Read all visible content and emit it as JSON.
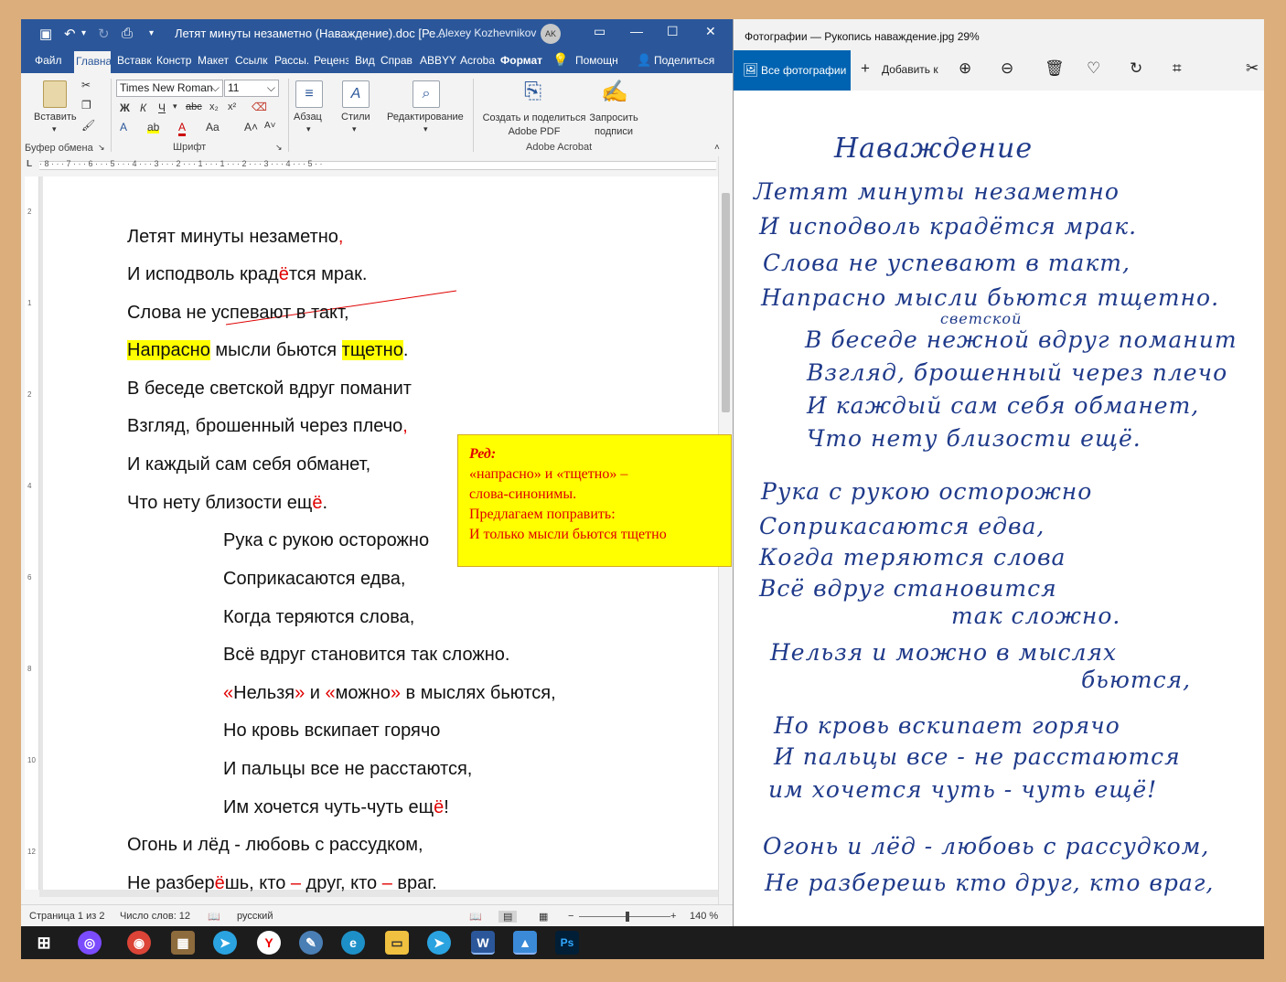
{
  "word": {
    "doc_title": "Летят минуты незаметно (Наваждение).doc [Ре...",
    "user_name": "Alexey Kozhevnikov",
    "user_initials": "AK",
    "tabs": [
      "Файл",
      "Главна",
      "Вставк",
      "Констр",
      "Макет",
      "Ссылк",
      "Рассы.",
      "Реценз",
      "Вид",
      "Справ",
      "ABBYY",
      "Acroba",
      "Формат",
      "Помощн",
      "Поделиться"
    ],
    "ribbon": {
      "paste": "Вставить",
      "clipboard_group": "Буфер обмена",
      "font_name": "Times New Roman",
      "font_size": "11",
      "font_group": "Шрифт",
      "paragraph": "Абзац",
      "styles": "Стили",
      "editing": "Редактирование",
      "create_pdf": "Создать и поделиться Adobe PDF",
      "request_sign": "Запросить подписи",
      "acrobat_group": "Adobe Acrobat"
    },
    "ruler_numbers": "· 8 · · · 7 · · · 6 · · · 5 · · · 4 · · · 3 · · · 2 · · · 1 · · · 1 · · · 2 · · · 3 · · · 4 · · · 5 · ·",
    "lines": [
      {
        "pre": "Летят минуты незаметно",
        "mark": ",",
        "post": ""
      },
      {
        "pre": "И исподволь крад",
        "mark": "ё",
        "post": "тся мрак."
      },
      {
        "pre": "Слова не успевают в такт,",
        "mark": "",
        "post": ""
      },
      {
        "hl1": "Напрасно",
        "mid": " мысли бьются ",
        "hl2": "тщетно",
        "post": "."
      },
      {
        "pre": "В беседе светской вдруг поманит",
        "mark": "",
        "post": ""
      },
      {
        "pre": "Взгляд, брошенный через плечо",
        "mark": ",",
        "post": ""
      },
      {
        "pre": "И каждый сам себя обманет,",
        "mark": "",
        "post": ""
      },
      {
        "pre": "Что нету близости ещ",
        "mark": "ё",
        "post": "."
      },
      {
        "pre": "Рука с рукою осторожно",
        "mark": "",
        "post": ""
      },
      {
        "pre": "Соприкасаются едва,",
        "mark": "",
        "post": ""
      },
      {
        "pre": "Когда теряются слова,",
        "mark": "",
        "post": ""
      },
      {
        "pre": "Всё вдруг становится так сложно.",
        "mark": "",
        "post": ""
      },
      {
        "q1": "«",
        "w1": "Нельзя",
        "q2": "»",
        "and": " и ",
        "q3": "«",
        "w2": "можно",
        "q4": "»",
        "post": " в мыслях бьются,"
      },
      {
        "pre": "Но кровь вскипает горячо",
        "mark": "",
        "post": ""
      },
      {
        "pre": "И пальцы все не расстаются,",
        "mark": "",
        "post": ""
      },
      {
        "pre": "Им хочется чуть-чуть ещ",
        "mark": "ё",
        "post": "!"
      },
      {
        "pre": "Огонь и лёд - любовь с рассудком,",
        "mark": "",
        "post": ""
      },
      {
        "a": "Не разбер",
        "e": "ё",
        "b": "шь, кто ",
        "d1": "–",
        "c": " друг, кто ",
        "d2": "–",
        "f": " враг."
      }
    ],
    "comment": {
      "label": "Ред:",
      "l1": "«напрасно» и «тщетно» –",
      "l2": "слова-синонимы.",
      "l3": "Предлагаем поправить:",
      "l4": "И только мысли бьются тщетно"
    },
    "status": {
      "page": "Страница 1 из 2",
      "words": "Число слов: 12",
      "lang": "русский",
      "zoom": "140 %"
    }
  },
  "photos": {
    "title": "Фотографии — Рукопись наваждение.jpg   29%",
    "all_photos": "Все фотографии",
    "add": "Добавить к",
    "handwriting": [
      "Наваждение",
      "Летят минуты незаметно",
      "И исподволь крадётся мрак.",
      "Слова не успевают в такт,",
      "Напрасно мысли бьются тщетно.",
      "светской",
      "В беседе нежной вдруг поманит",
      "Взгляд, брошенный через плечо",
      "И каждый сам себя обманет,",
      "Что нету близости ещё.",
      "Рука с рукою осторожно",
      "Соприкасаются едва,",
      "Когда теряются слова",
      "Всё вдруг становится",
      "так сложно.",
      "Нельзя и можно в мыслях",
      "бьются,",
      "Но кровь вскипает горячо",
      "И пальцы все - не расстаются",
      "им хочется чуть - чуть ещё!",
      "Огонь и лёд - любовь с рассудком,",
      "Не разберешь кто друг, кто враг,"
    ]
  }
}
